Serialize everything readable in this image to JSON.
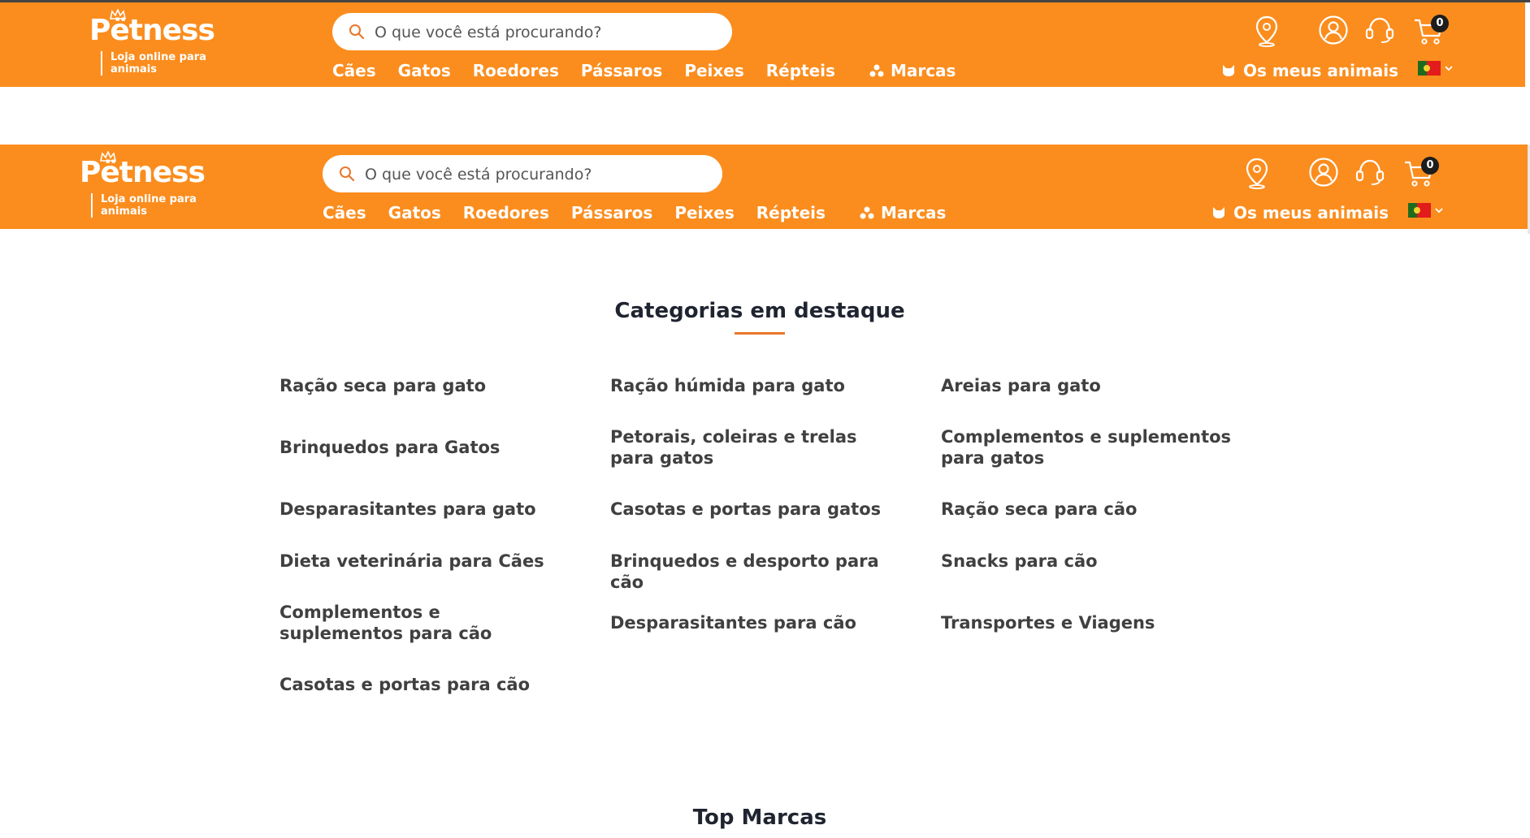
{
  "header": {
    "logo_text": "Pëtness",
    "logo_tagline": "Loja online para animais",
    "search_placeholder": "O que você está procurando?",
    "nav": [
      "Cães",
      "Gatos",
      "Roedores",
      "Pássaros",
      "Peixes",
      "Répteis"
    ],
    "brands_label": "Marcas",
    "pets_label": "Os meus animais",
    "cart_count": "0",
    "icons": [
      "store-locator-icon",
      "account-icon",
      "support-headset-icon",
      "cart-icon"
    ],
    "accent_color": "#fb8d1e",
    "country_flag": "flag-portugal-icon"
  },
  "featured": {
    "title": "Categorias em destaque",
    "items": [
      "Ração seca para gato",
      "Ração húmida para gato",
      "Areias para gato",
      "Brinquedos para Gatos",
      "Petorais, coleiras e trelas para gatos",
      "Complementos e suplementos para gatos",
      "Desparasitantes para gato",
      "Casotas e portas para gatos",
      "Ração seca para cão",
      "Dieta veterinária para Cães",
      "Brinquedos e desporto para cão",
      "Snacks para cão",
      "Complementos e suplementos para cão",
      "Desparasitantes para cão",
      "Transportes e Viagens",
      "Casotas e portas para cão"
    ]
  },
  "brands_section": {
    "title": "Top Marcas"
  }
}
